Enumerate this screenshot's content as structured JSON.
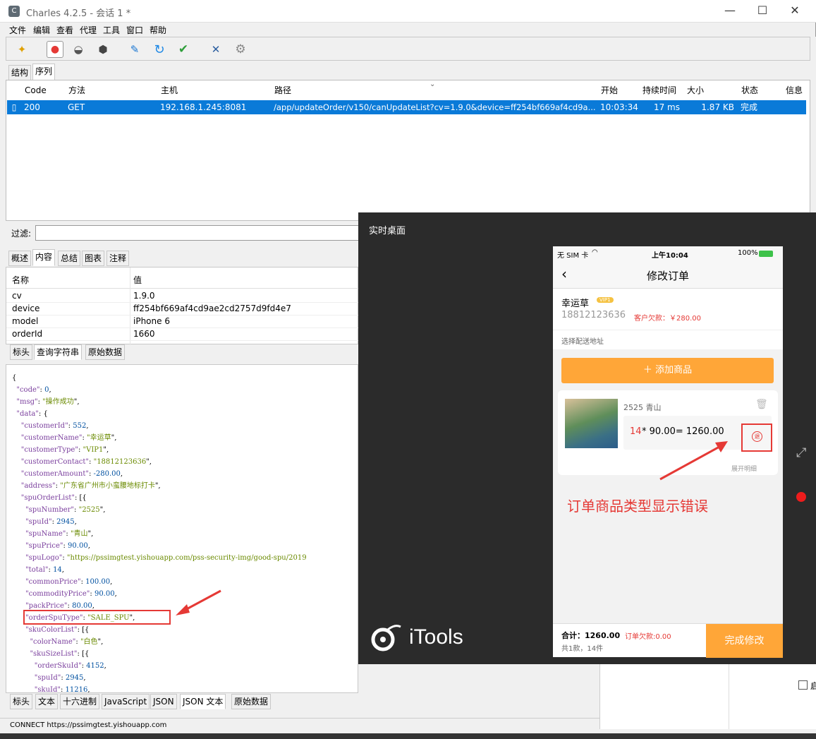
{
  "window": {
    "title": "Charles 4.2.5 - 会话 1 *",
    "app_icon": "charles-app-icon"
  },
  "menu": [
    "文件",
    "编辑",
    "查看",
    "代理",
    "工具",
    "窗口",
    "帮助"
  ],
  "toolbar": [
    {
      "icon": "broom-icon",
      "glyph": "🧹"
    },
    {
      "icon": "record-icon",
      "glyph": "●"
    },
    {
      "icon": "turtle-icon",
      "glyph": "🐢"
    },
    {
      "icon": "stop-icon",
      "glyph": "⬢"
    },
    {
      "icon": "pen-icon",
      "glyph": "✏"
    },
    {
      "icon": "refresh-icon",
      "glyph": "↻"
    },
    {
      "icon": "check-icon",
      "glyph": "✔"
    },
    {
      "icon": "tools-icon",
      "glyph": "🔧"
    },
    {
      "icon": "settings-icon",
      "glyph": "⚙"
    }
  ],
  "view_tabs": [
    "结构",
    "序列"
  ],
  "table": {
    "headers": [
      "Code",
      "方法",
      "主机",
      "路径",
      "开始",
      "持续时间",
      "大小",
      "状态",
      "信息"
    ],
    "row": {
      "code": "200",
      "method": "GET",
      "host": "192.168.1.245:8081",
      "path": "/app/updateOrder/v150/canUpdateList?cv=1.9.0&device=ff254bf669af4cd9a...",
      "start": "10:03:34",
      "duration": "17 ms",
      "size": "1.87 KB",
      "status": "完成"
    }
  },
  "filter": {
    "label": "过滤:"
  },
  "detail_tabs": [
    "概述",
    "内容",
    "总结",
    "图表",
    "注释"
  ],
  "params": {
    "headers": [
      "名称",
      "值"
    ],
    "rows": [
      {
        "name": "cv",
        "value": "1.9.0"
      },
      {
        "name": "device",
        "value": "ff254bf669af4cd9ae2cd2757d9fd4e7"
      },
      {
        "name": "model",
        "value": "iPhone 6"
      },
      {
        "name": "orderId",
        "value": "1660"
      }
    ]
  },
  "request_tabs": [
    "标头",
    "查询字符串",
    "原始数据"
  ],
  "json_lines": [
    "{",
    "  \"code\": 0,",
    "  \"msg\": \"操作成功\",",
    "  \"data\": {",
    "    \"customerId\": 552,",
    "    \"customerName\": \"幸运草\",",
    "    \"customerType\": \"VIP1\",",
    "    \"customerContact\": \"18812123636\",",
    "    \"customerAmount\": -280.00,",
    "    \"address\": \"广东省广州市小蛮腰地标打卡\",",
    "    \"spuOrderList\": [{",
    "      \"spuNumber\": \"2525\",",
    "      \"spuId\": 2945,",
    "      \"spuName\": \"青山\",",
    "      \"spuPrice\": 90.00,",
    "      \"spuLogo\": \"https://pssimgtest.yishouapp.com/pss-security-img/good-spu/2019",
    "      \"total\": 14,",
    "      \"commonPrice\": 100.00,",
    "      \"commodityPrice\": 90.00,",
    "      \"packPrice\": 80.00,",
    "      \"orderSpuType\": \"SALE_SPU\",",
    "      \"skuColorList\": [{",
    "        \"colorName\": \"白色\",",
    "        \"skuSizeList\": [{",
    "          \"orderSkuId\": 4152,",
    "          \"spuId\": 2945,",
    "          \"skuId\": 11216,"
  ],
  "response_tabs": [
    "标头",
    "文本",
    "十六进制",
    "JavaScript",
    "JSON",
    "JSON 文本",
    "原始数据"
  ],
  "status_text": "CONNECT https://pssimgtest.yishouapp.com",
  "remote": {
    "title": "实时桌面",
    "brand": "iTools",
    "phone": {
      "status": {
        "carrier": "无 SIM 卡",
        "time": "上午10:04",
        "battery": "100%"
      },
      "nav_title": "修改订单",
      "customer_name": "幸运草",
      "vip_badge": "VIP1",
      "phone": "18812123636",
      "debt": "客户欠款：￥280.00",
      "address_hint": "选择配送地址",
      "add_button": "添加商品",
      "product": {
        "code_name": "2525  青山",
        "qty": "14",
        "formula": " * 90.00= 1260.00",
        "return_badge": "退",
        "expand": "展开明细"
      },
      "total": "合计：1260.00",
      "order_debt": "订单欠款:0.00",
      "summary": "共1款，14件",
      "submit": "完成修改"
    },
    "annotation": "订单商品类型显示错误"
  },
  "side_panel": {
    "checkbox_label": "启"
  },
  "colors": {
    "accent": "#0a7ad8",
    "orange": "#ffa638",
    "red": "#e53935"
  }
}
